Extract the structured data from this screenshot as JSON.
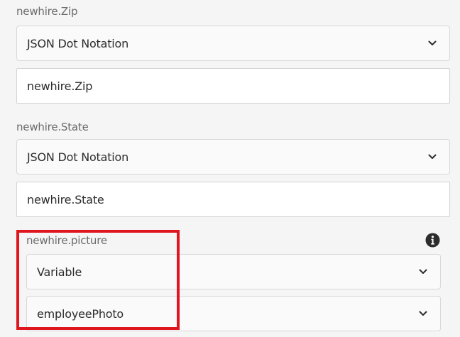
{
  "fields": [
    {
      "label": "newhire.Zip",
      "mapping_type": "JSON Dot Notation",
      "value": "newhire.Zip"
    },
    {
      "label": "newhire.State",
      "mapping_type": "JSON Dot Notation",
      "value": "newhire.State"
    },
    {
      "label": "newhire.picture",
      "mapping_type": "Variable",
      "value": "employeePhoto"
    }
  ],
  "icons": {
    "dropdown": "chevron-down-icon",
    "info": "info-icon"
  },
  "colors": {
    "highlight_border": "#e0161e",
    "background": "#f5f5f5"
  }
}
